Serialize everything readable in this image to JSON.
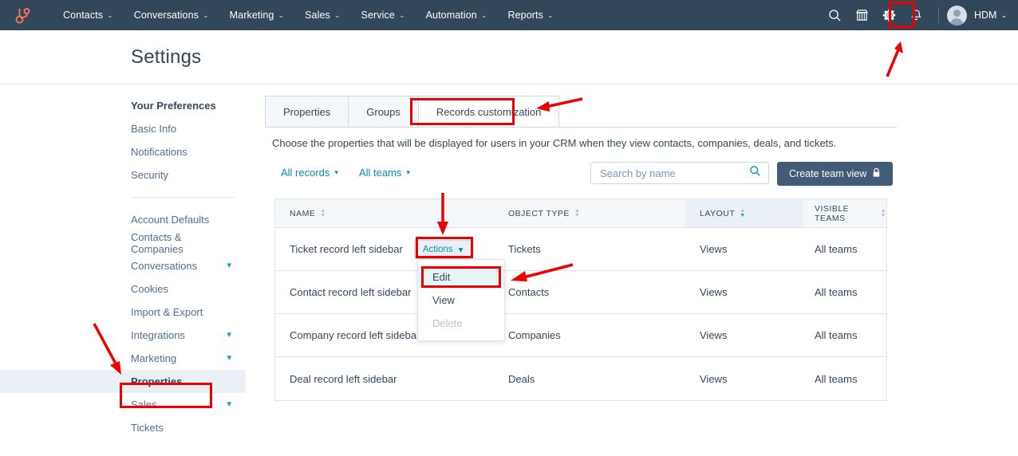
{
  "brand": {
    "accent_red": "#ee0000",
    "navbar_bg": "#33475b",
    "link_blue": "#0091ae",
    "teal": "#00a4bd",
    "button_navy": "#425b76"
  },
  "navbar": {
    "logo": "hubspot-sprocket-logo",
    "items": [
      {
        "label": "Contacts",
        "caret": "⌄"
      },
      {
        "label": "Conversations",
        "caret": "⌄"
      },
      {
        "label": "Marketing",
        "caret": "⌄"
      },
      {
        "label": "Sales",
        "caret": "⌄"
      },
      {
        "label": "Service",
        "caret": "⌄"
      },
      {
        "label": "Automation",
        "caret": "⌄"
      },
      {
        "label": "Reports",
        "caret": "⌄"
      }
    ],
    "icons": [
      "search-icon",
      "marketplace-icon",
      "settings-gear-icon",
      "notifications-bell-icon"
    ],
    "user": {
      "name": "HDM",
      "caret": "⌄"
    }
  },
  "header": {
    "title": "Settings"
  },
  "sidebar": {
    "items": [
      {
        "label": "Your Preferences",
        "type": "heading"
      },
      {
        "label": "Basic Info",
        "type": "link"
      },
      {
        "label": "Notifications",
        "type": "link"
      },
      {
        "label": "Security",
        "type": "link"
      },
      {
        "label": "Account Defaults",
        "type": "link"
      },
      {
        "label": "Contacts & Companies",
        "type": "link"
      },
      {
        "label": "Conversations",
        "type": "expandable"
      },
      {
        "label": "Cookies",
        "type": "link"
      },
      {
        "label": "Import & Export",
        "type": "link"
      },
      {
        "label": "Integrations",
        "type": "expandable"
      },
      {
        "label": "Marketing",
        "type": "expandable"
      },
      {
        "label": "Properties",
        "type": "link",
        "selected": true
      },
      {
        "label": "Sales",
        "type": "expandable"
      },
      {
        "label": "Tickets",
        "type": "link"
      }
    ]
  },
  "main": {
    "tabs": [
      {
        "label": "Properties",
        "active": false
      },
      {
        "label": "Groups",
        "active": false
      },
      {
        "label": "Records customization",
        "active": true
      }
    ],
    "description": "Choose the properties that will be displayed for users in your CRM when they view contacts, companies, deals, and tickets.",
    "filters": [
      {
        "label": "All records",
        "caret": "▾"
      },
      {
        "label": "All teams",
        "caret": "▾"
      }
    ],
    "search": {
      "placeholder": "Search by name",
      "value": "",
      "icon": "search-icon"
    },
    "create_button": {
      "label": "Create team view",
      "icon": "lock-icon"
    },
    "table": {
      "columns": [
        {
          "label": "NAME",
          "sorted": false
        },
        {
          "label": "OBJECT TYPE",
          "sorted": false
        },
        {
          "label": "LAYOUT",
          "sorted": true,
          "direction": "desc"
        },
        {
          "label": "VISIBLE TEAMS",
          "sorted": false
        }
      ],
      "rows": [
        {
          "name": "Ticket record left sidebar",
          "object_type": "Tickets",
          "layout": "Views",
          "visible_teams": "All teams",
          "actions_label": "Actions",
          "actions_open": true
        },
        {
          "name": "Contact record left sidebar",
          "object_type": "Contacts",
          "layout": "Views",
          "visible_teams": "All teams"
        },
        {
          "name": "Company record left sidebar",
          "object_type": "Companies",
          "layout": "Views",
          "visible_teams": "All teams"
        },
        {
          "name": "Deal record left sidebar",
          "object_type": "Deals",
          "layout": "Views",
          "visible_teams": "All teams"
        }
      ]
    },
    "actions_menu": [
      {
        "label": "Edit",
        "state": "highlighted"
      },
      {
        "label": "View",
        "state": "enabled"
      },
      {
        "label": "Delete",
        "state": "disabled"
      }
    ]
  },
  "annotations": {
    "highlight_boxes": [
      "settings-gear-icon",
      "records-customization-tab",
      "properties-sidebar-item",
      "actions-button",
      "edit-menu-item"
    ],
    "arrows": [
      "arrow-to-gear",
      "arrow-to-records-customization-tab",
      "arrow-to-properties-sidebar-item",
      "arrow-to-actions-button",
      "arrow-to-edit-menu-item"
    ]
  }
}
